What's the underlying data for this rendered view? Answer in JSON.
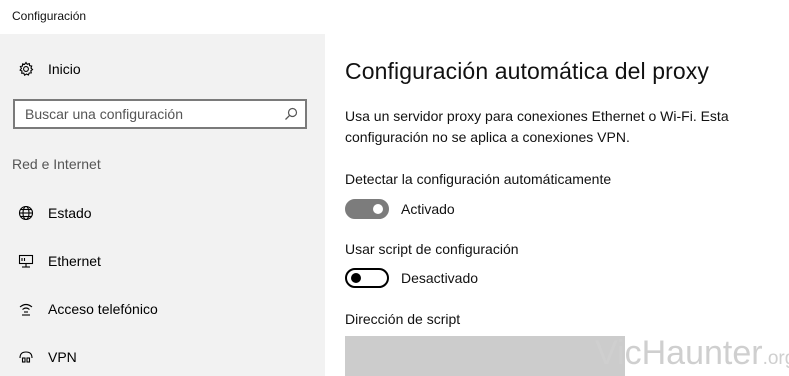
{
  "window": {
    "title": "Configuración"
  },
  "sidebar": {
    "home_label": "Inicio",
    "search_placeholder": "Buscar una configuración",
    "section_label": "Red e Internet",
    "items": [
      {
        "label": "Estado",
        "icon": "globe-icon"
      },
      {
        "label": "Ethernet",
        "icon": "ethernet-icon"
      },
      {
        "label": "Acceso telefónico",
        "icon": "dialup-icon"
      },
      {
        "label": "VPN",
        "icon": "vpn-icon"
      }
    ]
  },
  "main": {
    "title": "Configuración automática del proxy",
    "description": "Usa un servidor proxy para conexiones Ethernet o Wi-Fi. Esta configuración no se aplica a conexiones VPN.",
    "auto_detect": {
      "label": "Detectar la configuración automáticamente",
      "state": "Activado",
      "on": true
    },
    "use_script": {
      "label": "Usar script de configuración",
      "state": "Desactivado",
      "on": false
    },
    "script_address": {
      "label": "Dirección de script",
      "value": ""
    }
  },
  "watermark": {
    "text": "VicHaunter",
    "suffix": ".org"
  },
  "colors": {
    "toggle_on": "#7c7c7c",
    "sidebar_bg": "#f2f2f2",
    "disabled_input": "#cccccc"
  }
}
